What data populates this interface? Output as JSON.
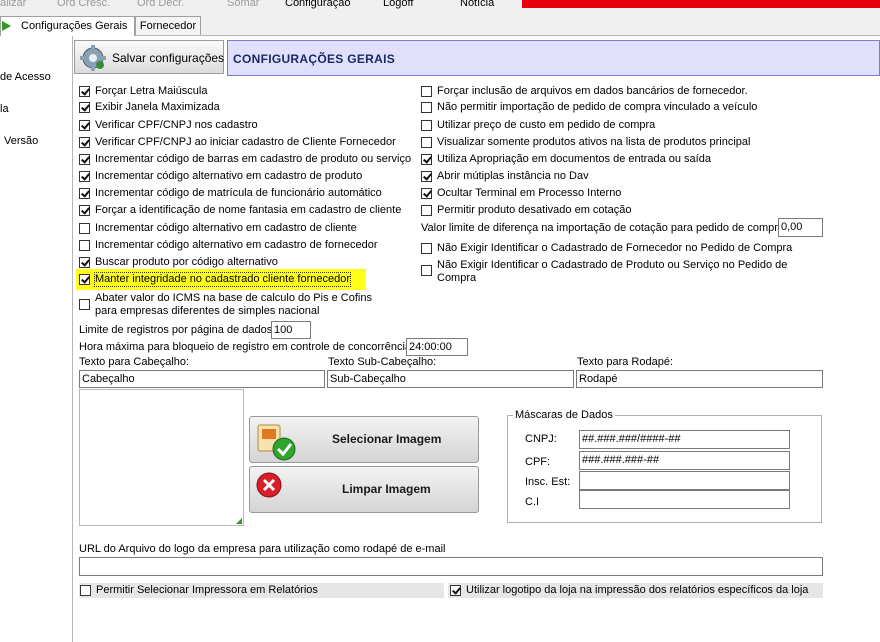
{
  "menu": {
    "items": [
      "alizar",
      "Ord Cresc.",
      "Ord Decr.",
      "Somar",
      "Configuração",
      "Logoff",
      "Notícia"
    ]
  },
  "tabs": [
    "Configurações Gerais",
    "Fornecedor"
  ],
  "sidebar": {
    "items": [
      "de Acesso",
      "la",
      "Versão"
    ]
  },
  "toolbar": {
    "save_label": "Salvar configurações"
  },
  "header": {
    "title": "CONFIGURAÇÕES GERAIS"
  },
  "left_options": [
    {
      "label": "Forçar Letra Maiúscula",
      "checked": true
    },
    {
      "label": "Exibir Janela Maximizada",
      "checked": true
    },
    {
      "label": "Verificar CPF/CNPJ nos cadastro",
      "checked": true
    },
    {
      "label": "Verificar CPF/CNPJ ao iniciar cadastro de Cliente Fornecedor",
      "checked": true
    },
    {
      "label": "Incrementar código de barras em cadastro de produto ou serviço",
      "checked": true
    },
    {
      "label": "Incrementar código alternativo em cadastro de produto",
      "checked": true
    },
    {
      "label": "Incrementar código de matrícula de funcionário automático",
      "checked": true
    },
    {
      "label": "Forçar a identificação de nome fantasia em cadastro de cliente",
      "checked": true
    },
    {
      "label": "Incrementar código alternativo em cadastro de  cliente",
      "checked": false
    },
    {
      "label": "Incrementar código alternativo em cadastro de  fornecedor",
      "checked": false
    },
    {
      "label": "Buscar produto por código alternativo",
      "checked": true
    },
    {
      "label": "Manter integridade no cadastrado cliente fornecedor",
      "checked": true,
      "highlighted": true
    },
    {
      "label": "Abater valor do ICMS na base de calculo do Pis e Cofins para empresas diferentes de simples nacional",
      "checked": false
    }
  ],
  "right_options": [
    {
      "label": "Forçar inclusão de arquivos em dados bancários de fornecedor.",
      "checked": false
    },
    {
      "label": "Não permitir importação de pedido de compra vinculado a veículo",
      "checked": false
    },
    {
      "label": "Utilizar preço de custo em pedido de compra",
      "checked": false
    },
    {
      "label": "Visualizar somente produtos ativos na lista de produtos principal",
      "checked": false
    },
    {
      "label": "Utiliza Apropriação em documentos de entrada ou saída",
      "checked": true
    },
    {
      "label": "Abrir mútiplas instância no Dav",
      "checked": true
    },
    {
      "label": "Ocultar Terminal em Processo Interno",
      "checked": true
    },
    {
      "label": "Permitir produto desativado em cotação",
      "checked": false
    }
  ],
  "limit_diff": {
    "label": "Valor limite de diferença na importação de cotação para pedido de compra:",
    "value": "0,00"
  },
  "right_options_2": [
    {
      "label": "Não Exigir Identificar o Cadastrado  de Fornecedor no Pedido de Compra",
      "checked": false
    },
    {
      "label": "Não Exigir Identificar o Cadastrado  de Produto ou Serviço no Pedido de Compra",
      "checked": false
    }
  ],
  "records_limit": {
    "label": "Limite de registros por página de dados:",
    "value": "100"
  },
  "max_time": {
    "label": "Hora máxima para bloqueio de registro em controle de concorrência:",
    "value": "24:00:00"
  },
  "texts": {
    "header_label": "Texto para Cabeçalho:",
    "header_value": "Cabeçalho",
    "subheader_label": "Texto Sub-Cabeçalho:",
    "subheader_value": "Sub-Cabeçalho",
    "footer_label": "Texto para Rodapé:",
    "footer_value": "Rodapé"
  },
  "buttons": {
    "select_image": "Selecionar Imagem",
    "clear_image": "Limpar Imagem"
  },
  "masks": {
    "legend": "Máscaras de Dados",
    "fields": [
      {
        "label": "CNPJ:",
        "value": "##.###.###/####-##"
      },
      {
        "label": "CPF:",
        "value": "###.###.###-##"
      },
      {
        "label": "Insc. Est:",
        "value": ""
      },
      {
        "label": "C.I",
        "value": ""
      }
    ]
  },
  "logo_url": {
    "label": "URL do Arquivo do logo da empresa para utilização como rodapé de e-mail",
    "value": ""
  },
  "bottom_options": [
    {
      "label": "Permitir Selecionar Impressora em Relatórios",
      "checked": false
    },
    {
      "label": "Utilizar logotipo da loja na impressão dos relatórios específicos da loja",
      "checked": true
    }
  ],
  "colors": {
    "accent_red": "#e8000f",
    "header_bg": "#e0e0fd",
    "highlight": "#ffff1a"
  }
}
